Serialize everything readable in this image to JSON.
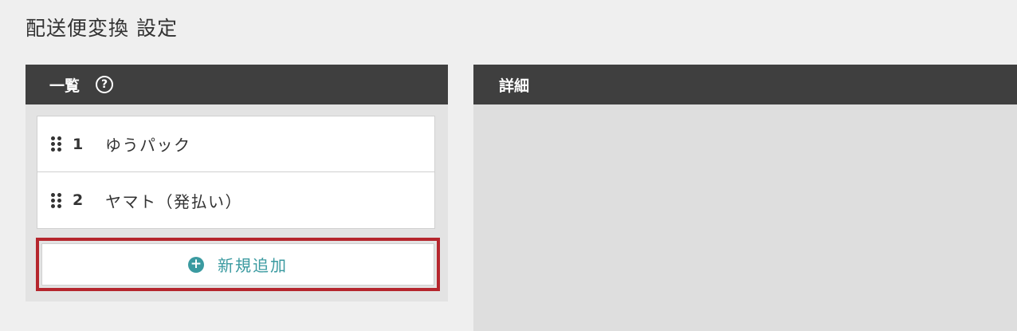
{
  "page": {
    "title": "配送便変換 設定"
  },
  "list_panel": {
    "header": "一覧",
    "help_icon": "question-circle-icon",
    "items": [
      {
        "number": "1",
        "name": "ゆうパック"
      },
      {
        "number": "2",
        "name": "ヤマト（発払い）"
      }
    ],
    "add_button": {
      "icon": "plus-circle-icon",
      "label": "新規追加"
    }
  },
  "detail_panel": {
    "header": "詳細"
  },
  "colors": {
    "header_bg": "#3f3f3f",
    "accent_teal": "#3a9aa0",
    "highlight_red": "#b5262d"
  }
}
